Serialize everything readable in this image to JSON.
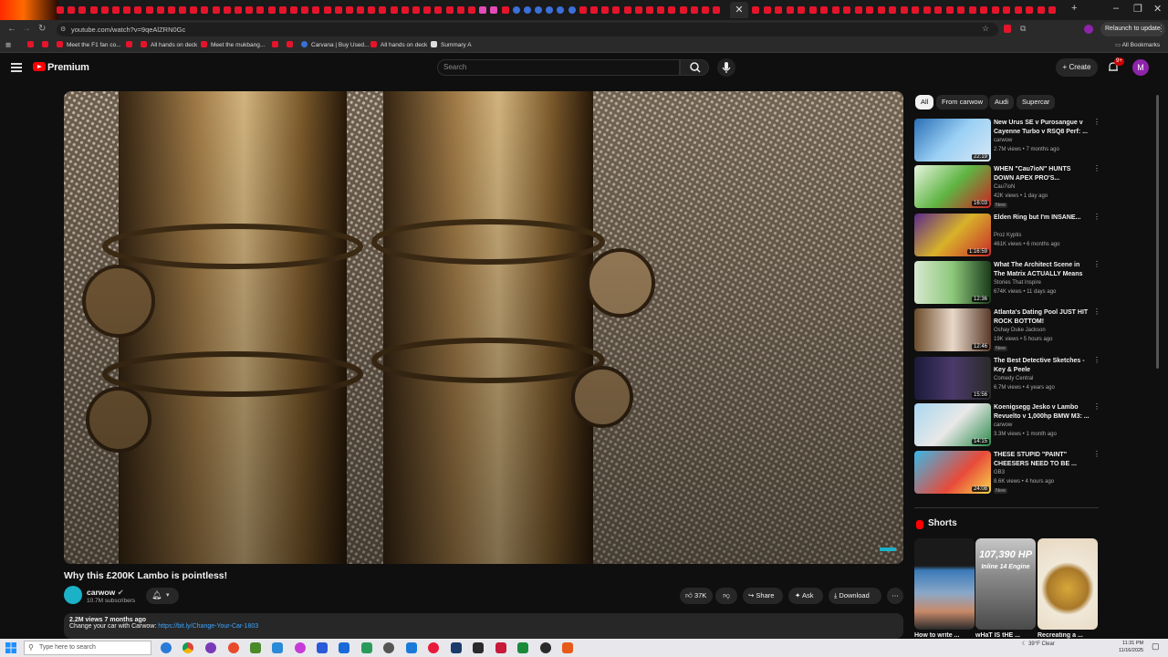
{
  "browser": {
    "url": "youtube.com/watch?v=9qeAlZRN0Gc",
    "relaunch_label": "Relaunch to update",
    "bookmarks": [
      "Meet the F1 fan co...",
      "All hands on deck",
      "Meet the mukbang...",
      "Carvana | Buy Used...",
      "All hands on deck",
      "Summary A"
    ],
    "all_bookmarks_label": "All Bookmarks"
  },
  "header": {
    "brand": "Premium",
    "search_placeholder": "Search",
    "create_label": "Create",
    "notification_count": "9+",
    "avatar_letter": "M"
  },
  "video": {
    "title": "Why this £200K Lambo is pointless!",
    "channel": "carwow",
    "subscribers": "10.7M subscribers",
    "likes": "37K",
    "share_label": "Share",
    "ask_label": "Ask",
    "download_label": "Download",
    "views_age": "2.2M views  7 months ago",
    "description": "Change your car with Carwow: ",
    "description_link": "https://bit.ly/Change-Your-Car-1803"
  },
  "chips": [
    "All",
    "From carwow",
    "Audi",
    "Supercar"
  ],
  "recommendations": [
    {
      "title": "New Urus SE v Purosangue v Cayenne Turbo v RSQ8 Perf: ...",
      "channel": "carwow",
      "views": "2.7M views • 7 months ago",
      "duration": "22:19",
      "badge": ""
    },
    {
      "title": "WHEN \"Cau7ioN\" HUNTS DOWN APEX PRO'S...",
      "channel": "Cau7ioN",
      "views": "42K views • 1 day ago",
      "duration": "16:03",
      "badge": "New"
    },
    {
      "title": "Elden Ring but I'm INSANE...",
      "channel": "Proz Kyptis",
      "views": "461K views • 6 months ago",
      "duration": "1:16:59",
      "badge": ""
    },
    {
      "title": "What The Architect Scene in The Matrix ACTUALLY Means",
      "channel": "Stories That Inspire",
      "views": "674K views • 11 days ago",
      "duration": "12:36",
      "badge": ""
    },
    {
      "title": "Atlanta's Dating Pool JUST HIT ROCK BOTTOM!",
      "channel": "Oshay Duke Jackson",
      "views": "19K views • 5 hours ago",
      "duration": "12:46",
      "badge": "New"
    },
    {
      "title": "The Best Detective Sketches - Key & Peele",
      "channel": "Comedy Central",
      "views": "6.7M views • 4 years ago",
      "duration": "15:56",
      "badge": ""
    },
    {
      "title": "Koenigsegg Jesko v Lambo Revuelto v 1,000hp BMW M3: ...",
      "channel": "carwow",
      "views": "3.3M views • 1 month ago",
      "duration": "14:15",
      "badge": ""
    },
    {
      "title": "THESE STUPID \"PAINT\" CHEESERS NEED TO BE ...",
      "channel": "GB3",
      "views": "8.6K views • 4 hours ago",
      "duration": "24:08",
      "badge": "New"
    }
  ],
  "shorts": {
    "heading": "Shorts",
    "items": [
      {
        "title": "How to write ..."
      },
      {
        "title": "wHaT IS tHE ..."
      },
      {
        "title": "Recreating a ..."
      }
    ],
    "overlay_text_1": "107,390 HP",
    "overlay_text_2": "Inline 14 Engine"
  },
  "taskbar": {
    "search_placeholder": "Type here to search",
    "weather": "39°F  Clear",
    "time": "11:31 PM",
    "date": "11/16/2025"
  }
}
